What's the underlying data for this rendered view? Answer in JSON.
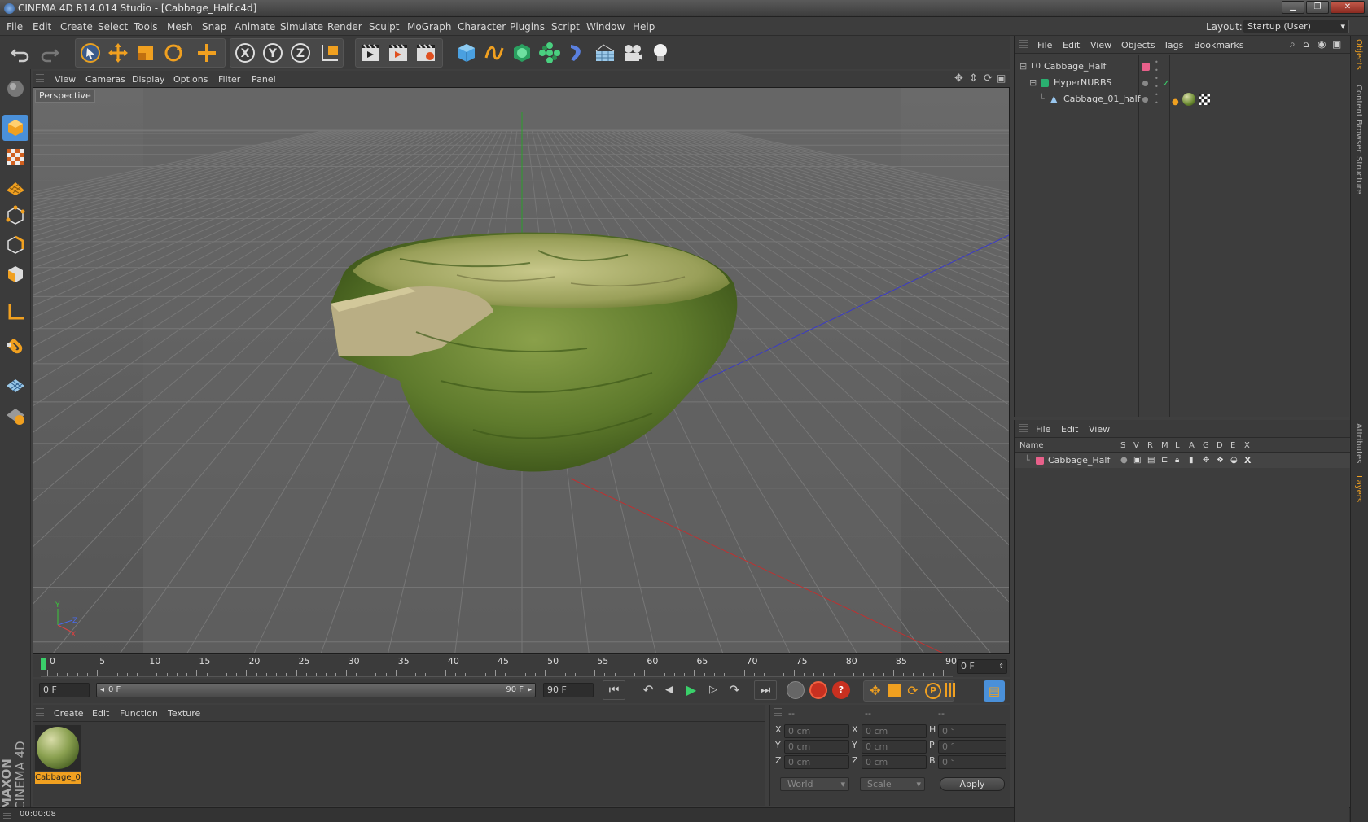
{
  "window": {
    "title": "CINEMA 4D R14.014 Studio - [Cabbage_Half.c4d]",
    "controls": [
      "minimize",
      "maximize",
      "close"
    ]
  },
  "menu": [
    "File",
    "Edit",
    "Create",
    "Select",
    "Tools",
    "Mesh",
    "Snap",
    "Animate",
    "Simulate",
    "Render",
    "Sculpt",
    "MoGraph",
    "Character",
    "Plugins",
    "Script",
    "Window",
    "Help"
  ],
  "layout": {
    "label": "Layout:",
    "value": "Startup (User)"
  },
  "toolbar_icons": [
    "undo-icon",
    "redo-icon",
    "live-select-icon",
    "move-icon",
    "scale-icon",
    "rotate-icon",
    "add-icon",
    "x-axis-icon",
    "y-axis-icon",
    "z-axis-icon",
    "coord-system-icon",
    "render-view-icon",
    "render-picture-viewer-icon",
    "render-settings-icon",
    "cube-icon",
    "spline-icon",
    "nurbs-icon",
    "array-icon",
    "deformer-icon",
    "scene-icon",
    "camera-icon",
    "light-icon"
  ],
  "left_tools": [
    "model-mode-icon",
    "object-mode-icon",
    "texture-mode-icon",
    "points-mode-icon",
    "edges-mode-icon",
    "polygons-mode-icon",
    "axis-icon",
    "magnet-icon",
    "workplane-icon",
    "locked-workplane-icon"
  ],
  "viewport": {
    "menu": [
      "View",
      "Cameras",
      "Display",
      "Options",
      "Filter",
      "Panel"
    ],
    "label": "Perspective"
  },
  "timeline": {
    "ticks": [
      "0",
      "5",
      "10",
      "15",
      "20",
      "25",
      "30",
      "35",
      "40",
      "45",
      "50",
      "55",
      "60",
      "65",
      "70",
      "75",
      "80",
      "85",
      "90"
    ],
    "current_frame": "0 F"
  },
  "transport": {
    "start": "0 F",
    "range_start": "0 F",
    "range_end": "90 F",
    "end": "90 F"
  },
  "materials": {
    "menu": [
      "Create",
      "Edit",
      "Function",
      "Texture"
    ],
    "items": [
      {
        "name": "Cabbage_0"
      }
    ]
  },
  "coords": {
    "headers": [
      "--",
      "--",
      "--"
    ],
    "rows": [
      {
        "a": "X",
        "av": "0 cm",
        "b": "X",
        "bv": "0 cm",
        "c": "H",
        "cv": "0 °"
      },
      {
        "a": "Y",
        "av": "0 cm",
        "b": "Y",
        "bv": "0 cm",
        "c": "P",
        "cv": "0 °"
      },
      {
        "a": "Z",
        "av": "0 cm",
        "b": "Z",
        "bv": "0 cm",
        "c": "B",
        "cv": "0 °"
      }
    ],
    "mode1": "World",
    "mode2": "Scale",
    "apply": "Apply"
  },
  "status": {
    "time": "00:00:08"
  },
  "objects": {
    "menu": [
      "File",
      "Edit",
      "View",
      "Objects",
      "Tags",
      "Bookmarks"
    ],
    "tree": [
      {
        "name": "Cabbage_Half",
        "indent": 0
      },
      {
        "name": "HyperNURBS",
        "indent": 1
      },
      {
        "name": "Cabbage_01_half",
        "indent": 2
      }
    ]
  },
  "layers": {
    "menu": [
      "File",
      "Edit",
      "View"
    ],
    "columns": [
      "Name",
      "S",
      "V",
      "R",
      "M",
      "L",
      "A",
      "G",
      "D",
      "E",
      "X"
    ],
    "items": [
      {
        "name": "Cabbage_Half",
        "color": "#e8608a"
      }
    ]
  },
  "side_tabs": [
    "Objects",
    "Content Browser",
    "Structure",
    "Attributes",
    "Layers"
  ],
  "brand": {
    "line1": "MAXON",
    "line2": "CINEMA 4D"
  },
  "colors": {
    "accent_orange": "#f0a020",
    "selection": "#4a90d9",
    "layer_pink": "#e8608a"
  }
}
